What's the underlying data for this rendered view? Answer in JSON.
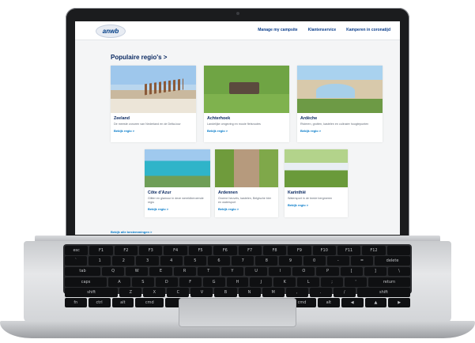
{
  "header": {
    "logo_text": "anwb",
    "nav": [
      "Manage my campsite",
      "Klantenservice",
      "Kamperen in coronatijd"
    ]
  },
  "main": {
    "title": "Populaire regio's >",
    "cards": [
      {
        "title": "Zeeland",
        "desc": "De meeste zonuren van Nederland en de Delta-tour",
        "link": "Bekijk regio >"
      },
      {
        "title": "Achterhoek",
        "desc": "Landelijke omgeving en mooie fietsroutes",
        "link": "Bekijk regio >"
      },
      {
        "title": "Ardèche",
        "desc": "Rivieren, grotten, kastelen en culinaire hoogtepunten",
        "link": "Bekijk regio >"
      },
      {
        "title": "Côte d'Azur",
        "desc": "Glitter en glamour in deze wereldberoemde regio",
        "link": "Bekijk regio >"
      },
      {
        "title": "Ardennen",
        "desc": "Groene heuvels, kastelen, Belgische bier en watersport",
        "link": "Bekijk regio >"
      },
      {
        "title": "Karinthië",
        "desc": "Watersport in de brede bergmeren",
        "link": "Bekijk regio >"
      }
    ],
    "all_link": "Bekijk alle bestemmingen >"
  },
  "keyboard": {
    "rows": [
      [
        "esc",
        "F1",
        "F2",
        "F3",
        "F4",
        "F5",
        "F6",
        "F7",
        "F8",
        "F9",
        "F10",
        "F11",
        "F12",
        ""
      ],
      [
        "`",
        "1",
        "2",
        "3",
        "4",
        "5",
        "6",
        "7",
        "8",
        "9",
        "0",
        "-",
        "=",
        "delete"
      ],
      [
        "tab",
        "Q",
        "W",
        "E",
        "R",
        "T",
        "Y",
        "U",
        "I",
        "O",
        "P",
        "[",
        "]",
        "\\"
      ],
      [
        "caps",
        "A",
        "S",
        "D",
        "F",
        "G",
        "H",
        "J",
        "K",
        "L",
        ";",
        "'",
        "return"
      ],
      [
        "shift",
        "Z",
        "X",
        "C",
        "V",
        "B",
        "N",
        "M",
        ",",
        ".",
        "/",
        "shift"
      ],
      [
        "fn",
        "ctrl",
        "alt",
        "cmd",
        "",
        "cmd",
        "alt",
        "◀",
        "▲",
        "▶"
      ]
    ]
  },
  "colors": {
    "brand_blue": "#0b3e8c",
    "link_blue": "#0078c8",
    "heading_navy": "#0b2a62"
  }
}
